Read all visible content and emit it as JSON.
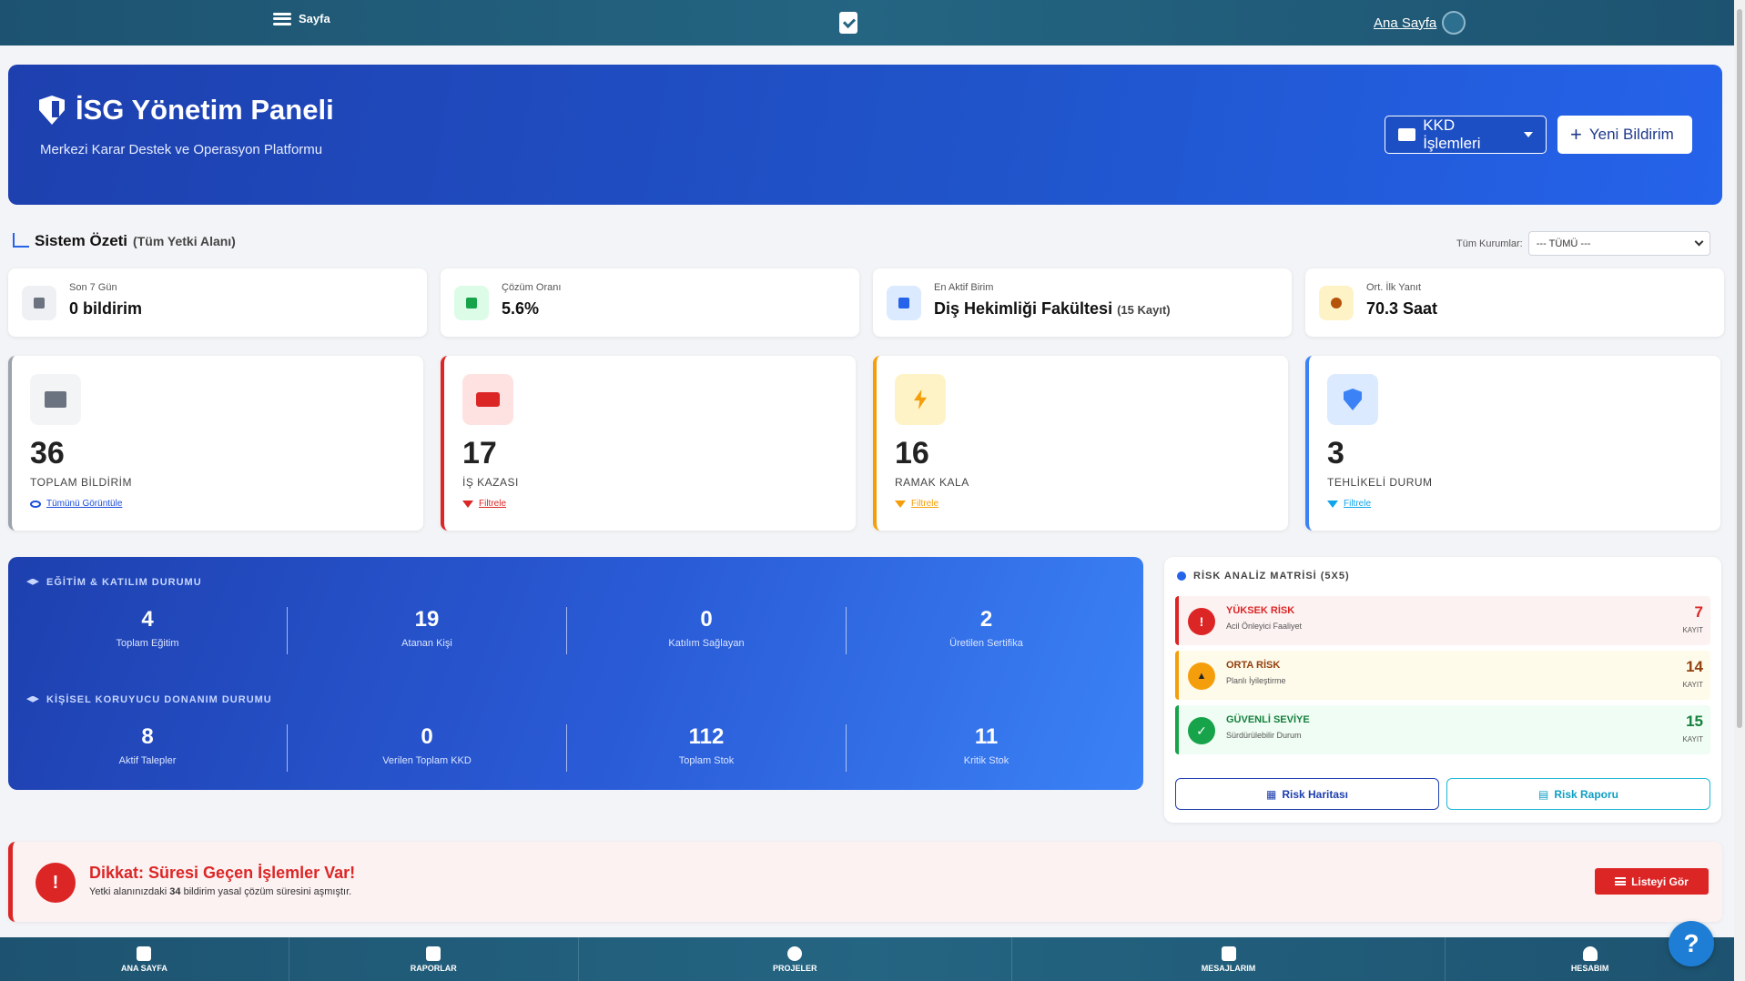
{
  "topbar": {
    "menu_label": "Sayfa",
    "home_label": "Ana Sayfa"
  },
  "hero": {
    "title": "İSG Yönetim Paneli",
    "subtitle": "Merkezi Karar Destek ve Operasyon Platformu",
    "kkd_button": "KKD İşlemleri",
    "new_button": "Yeni Bildirim"
  },
  "summary": {
    "title": "Sistem Özeti",
    "scope": "(Tüm Yetki Alanı)",
    "filter_label": "Tüm Kurumlar:",
    "filter_value": "--- TÜMÜ ---"
  },
  "mini_cards": [
    {
      "label": "Son 7 Gün",
      "value": "0 bildirim",
      "icon": "calendar-icon",
      "color": "#6b7280"
    },
    {
      "label": "Çözüm Oranı",
      "value": "5.6%",
      "icon": "chart-line-icon",
      "color": "#16a34a"
    },
    {
      "label": "En Aktif Birim",
      "value": "Diş Hekimliği Fakültesi",
      "extra": "(15 Kayıt)",
      "icon": "building-icon",
      "color": "#2563eb"
    },
    {
      "label": "Ort. İlk Yanıt",
      "value": "70.3 Saat",
      "icon": "stopwatch-icon",
      "color": "#d97706"
    }
  ],
  "big_cards": [
    {
      "count": "36",
      "label": "TOPLAM BİLDİRİM",
      "link": "Tümünü Görüntüle",
      "icon": "folder-icon",
      "color": "#9ca3af"
    },
    {
      "count": "17",
      "label": "İŞ KAZASI",
      "link": "Filtrele",
      "icon": "ambulance-icon",
      "color": "#dc2626"
    },
    {
      "count": "16",
      "label": "RAMAK KALA",
      "link": "Filtrele",
      "icon": "bolt-icon",
      "color": "#f59e0b"
    },
    {
      "count": "3",
      "label": "TEHLİKELİ DURUM",
      "link": "Filtrele",
      "icon": "shield-icon",
      "color": "#3b82f6"
    }
  ],
  "training": {
    "title": "EĞİTİM & KATILIM DURUMU",
    "stats": [
      {
        "value": "4",
        "label": "Toplam Eğitim"
      },
      {
        "value": "19",
        "label": "Atanan Kişi"
      },
      {
        "value": "0",
        "label": "Katılım Sağlayan"
      },
      {
        "value": "2",
        "label": "Üretilen Sertifika"
      }
    ]
  },
  "ppe": {
    "title": "KİŞİSEL KORUYUCU DONANIM DURUMU",
    "stats": [
      {
        "value": "8",
        "label": "Aktif Talepler"
      },
      {
        "value": "0",
        "label": "Verilen Toplam KKD"
      },
      {
        "value": "112",
        "label": "Toplam Stok"
      },
      {
        "value": "11",
        "label": "Kritik Stok"
      }
    ]
  },
  "risk": {
    "title": "RİSK ANALİZ MATRİSİ (5X5)",
    "items": [
      {
        "title": "YÜKSEK RİSK",
        "sub": "Acil Önleyici Faaliyet",
        "count": "7",
        "unit": "KAYIT",
        "color": "#dc2626",
        "bg": "#fdf2f2",
        "glyph": "!"
      },
      {
        "title": "ORTA RİSK",
        "sub": "Planlı İyileştirme",
        "count": "14",
        "unit": "KAYIT",
        "color": "#b45309",
        "bg": "#fffbeb",
        "glyph": "▲"
      },
      {
        "title": "GÜVENLİ SEVİYE",
        "sub": "Sürdürülebilir Durum",
        "count": "15",
        "unit": "KAYIT",
        "color": "#15803d",
        "bg": "#f0fdf4",
        "glyph": "✓"
      }
    ],
    "map_button": "Risk Haritası",
    "report_button": "Risk Raporu"
  },
  "alert": {
    "title": "Dikkat: Süresi Geçen İşlemler Var!",
    "text_before": "Yetki alanınızdaki ",
    "count": "34",
    "text_after": " bildirim yasal çözüm süresini aşmıştır.",
    "button": "Listeyi Gör"
  },
  "bottom_nav": [
    "ANA SAYFA",
    "RAPORLAR",
    "PROJELER",
    "MESAJLARIM",
    "HESABIM"
  ],
  "help": "?"
}
